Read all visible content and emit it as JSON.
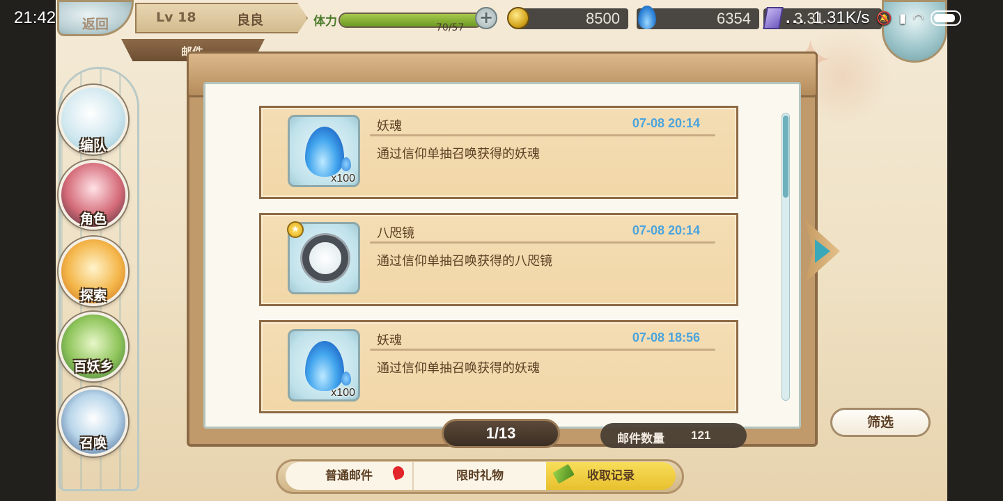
{
  "status_bar": {
    "time": "21:42",
    "network": "1.31K/s",
    "dots": "..."
  },
  "hud": {
    "back_label": "返回",
    "level": "Lv 18",
    "player_name": "良良",
    "stamina_label": "体力",
    "stamina_value": "70/57",
    "stamina_fraction": 1.0,
    "coins": "8500",
    "souls": "6354",
    "crystals": "3.31"
  },
  "section_title": "邮件",
  "sidebar": {
    "items": [
      {
        "label": "编队",
        "icon": "team-icon"
      },
      {
        "label": "角色",
        "icon": "character-icon"
      },
      {
        "label": "探索",
        "icon": "explore-icon"
      },
      {
        "label": "百妖乡",
        "icon": "village-icon"
      },
      {
        "label": "召唤",
        "icon": "summon-icon"
      }
    ]
  },
  "mails": [
    {
      "title": "妖魂",
      "time": "07-08 20:14",
      "desc": "通过信仰单抽召唤获得的妖魂",
      "item_icon": "soul-flame-icon",
      "qty": "x100"
    },
    {
      "title": "八咫镜",
      "time": "07-08 20:14",
      "desc": "通过信仰单抽召唤获得的八咫镜",
      "item_icon": "mirror-icon",
      "qty": ""
    },
    {
      "title": "妖魂",
      "time": "07-08 18:56",
      "desc": "通过信仰单抽召唤获得的妖魂",
      "item_icon": "soul-flame-icon",
      "qty": "x100"
    }
  ],
  "pager": "1/13",
  "mail_count_label": "邮件数量",
  "mail_count": "121",
  "filter_label": "筛选",
  "tabs": [
    {
      "label": "普通邮件",
      "active": false
    },
    {
      "label": "限时礼物",
      "active": false
    },
    {
      "label": "收取记录",
      "active": true
    }
  ],
  "colors": {
    "time_text": "#4aa4dd",
    "active_tab": "#f0cc3a",
    "stamina": "#8ab63a"
  }
}
